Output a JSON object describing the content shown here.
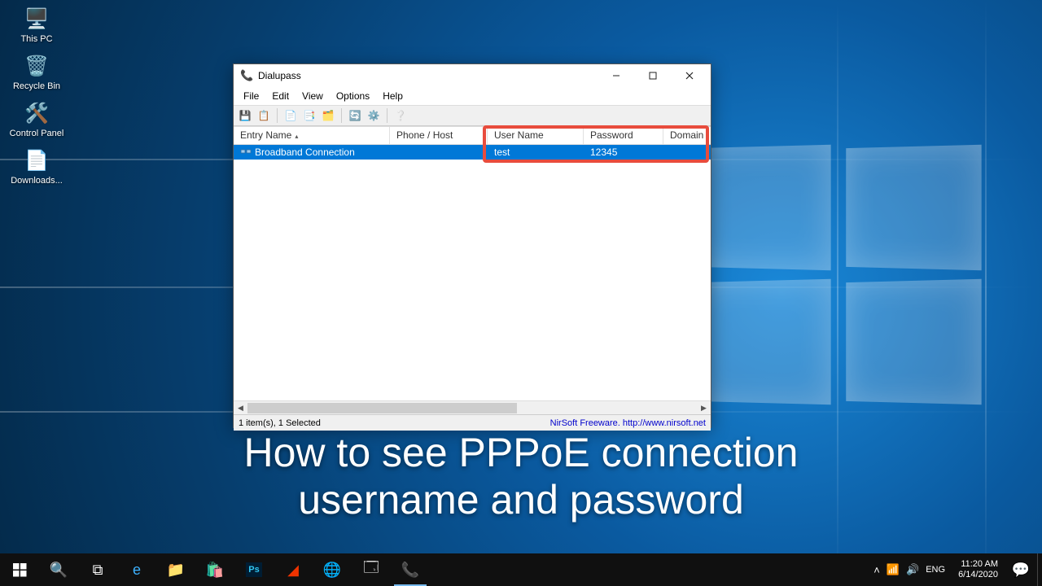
{
  "desktop_icons": [
    {
      "label": "This PC",
      "icon": "🖥️"
    },
    {
      "label": "Recycle Bin",
      "icon": "🗑️"
    },
    {
      "label": "Control Panel",
      "icon": "🛠️"
    },
    {
      "label": "Downloads...",
      "icon": "📄"
    }
  ],
  "app": {
    "title": "Dialupass",
    "menus": [
      "File",
      "Edit",
      "View",
      "Options",
      "Help"
    ],
    "toolbar_icons": [
      "save-icon",
      "props-icon",
      "copy-icon",
      "copy-icon",
      "find-icon",
      "refresh-icon",
      "options-icon",
      "about-icon"
    ],
    "columns": [
      {
        "label": "Entry Name",
        "cls": "c-entry",
        "sorted": true
      },
      {
        "label": "Phone / Host",
        "cls": "c-phone"
      },
      {
        "label": "User Name",
        "cls": "c-user"
      },
      {
        "label": "Password",
        "cls": "c-pass"
      },
      {
        "label": "Domain",
        "cls": "c-dom"
      }
    ],
    "rows": [
      {
        "entry": "Broadband Connection",
        "phone": "",
        "user": "test",
        "pass": "12345",
        "domain": ""
      }
    ],
    "status_left": "1 item(s), 1 Selected",
    "status_right": "NirSoft Freeware.  http://www.nirsoft.net"
  },
  "caption_line1": "How to see PPPoE connection",
  "caption_line2": "username and password",
  "taskbar": {
    "tray_up": "˄",
    "time": "11:20 AM",
    "date": "6/14/2020"
  }
}
